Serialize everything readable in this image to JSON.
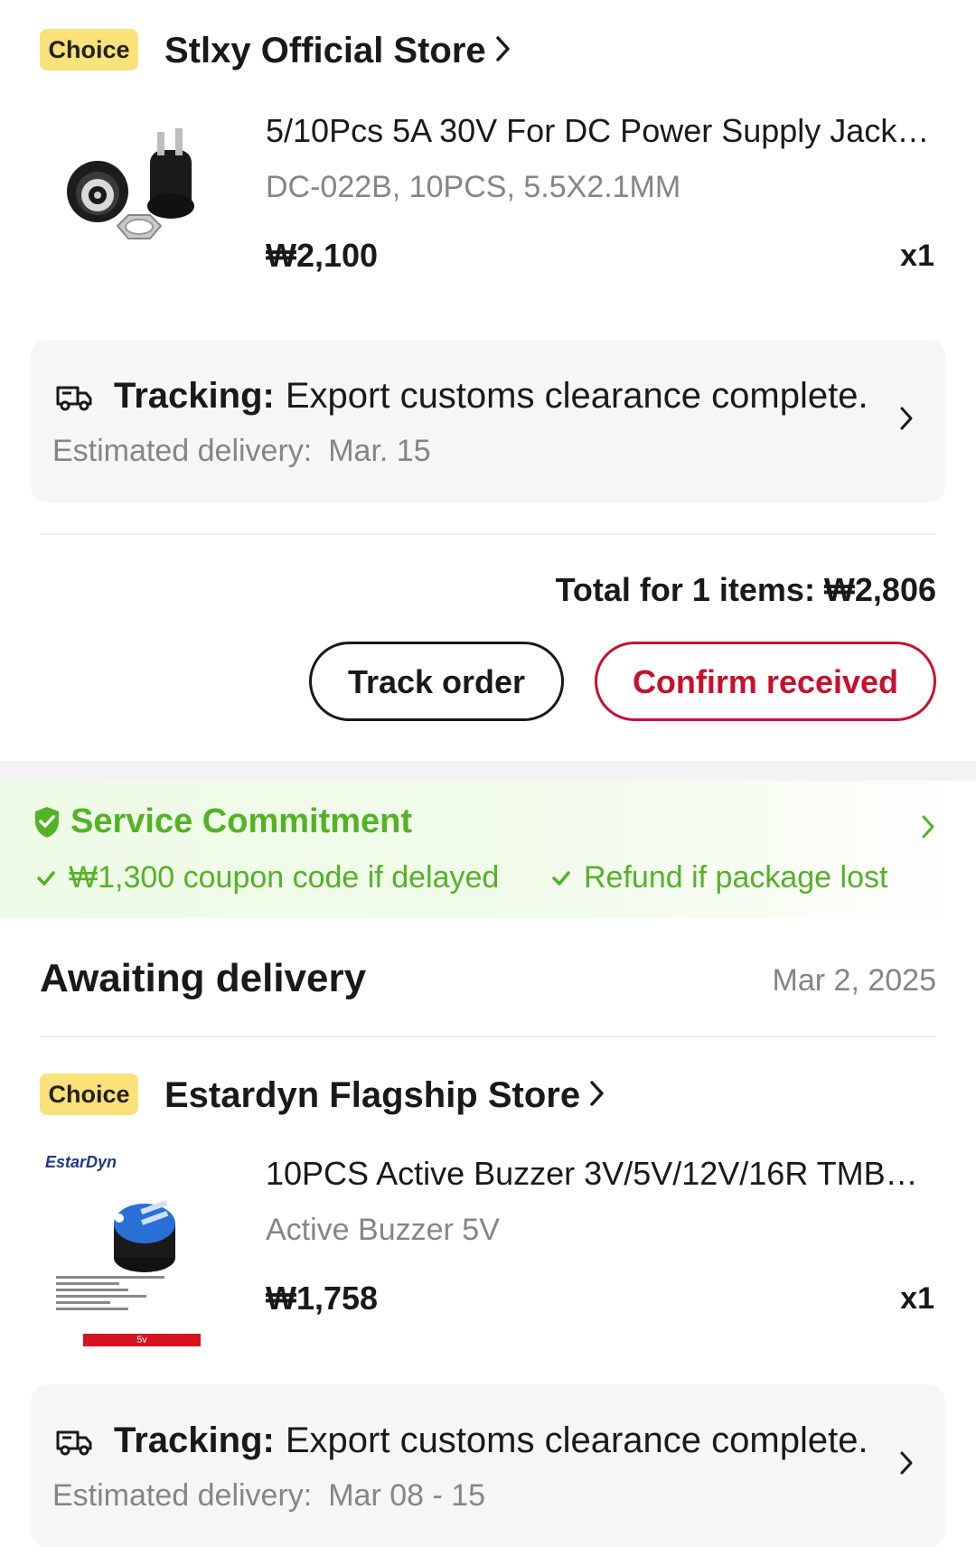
{
  "orders": [
    {
      "store": {
        "badge": "Choice",
        "name": "Stlxy Official Store"
      },
      "product": {
        "title": "5/10Pcs 5A 30V For DC Power Supply Jack…",
        "variant": "DC-022B, 10PCS, 5.5X2.1MM",
        "price": "₩2,100",
        "qty": "x1",
        "image_icon": "dc-power-jack-image"
      },
      "tracking": {
        "label": "Tracking:",
        "status": "Export customs clearance complete.",
        "est_label": "Estimated delivery:",
        "est_value": "Mar. 15"
      },
      "total": "Total for 1 items: ₩2,806",
      "buttons": {
        "track": "Track order",
        "confirm": "Confirm received"
      }
    }
  ],
  "service": {
    "title": "Service Commitment",
    "items": [
      "₩1,300 coupon code if delayed",
      "Refund if package lost"
    ],
    "color": "#53b226"
  },
  "section": {
    "title": "Awaiting delivery",
    "date": "Mar 2, 2025"
  },
  "order2": {
    "store": {
      "badge": "Choice",
      "name": "Estardyn Flagship Store"
    },
    "product": {
      "title": "10PCS Active Buzzer 3V/5V/12V/16R TMB…",
      "variant": "Active Buzzer 5V",
      "price": "₩1,758",
      "qty": "x1",
      "image_brand": "EstarDyn",
      "image_tag": "5v",
      "image_icon": "active-buzzer-image"
    },
    "tracking": {
      "label": "Tracking:",
      "status": "Export customs clearance complete.",
      "est_label": "Estimated delivery:",
      "est_value": "Mar 08 - 15"
    }
  },
  "colors": {
    "accent_red": "#c8102e",
    "choice_yellow": "#fbe179",
    "service_green": "#53b226"
  }
}
